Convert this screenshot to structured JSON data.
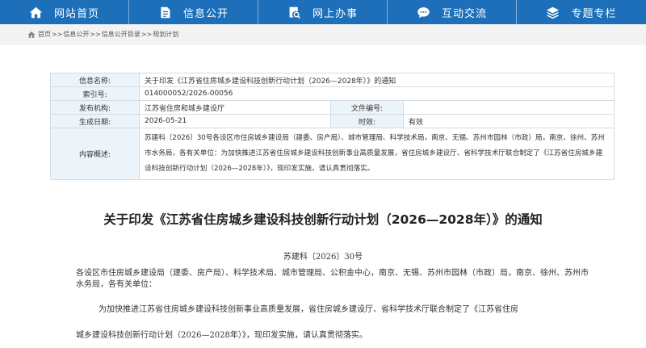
{
  "nav": [
    {
      "label": "网站首页",
      "icon": "home-icon"
    },
    {
      "label": "信息公开",
      "icon": "document-icon"
    },
    {
      "label": "网上办事",
      "icon": "search-document-icon"
    },
    {
      "label": "互动交流",
      "icon": "chat-icon"
    },
    {
      "label": "专题专栏",
      "icon": "layers-icon"
    }
  ],
  "breadcrumb": {
    "home": "首页",
    "level1": "信息公开",
    "level2": "信息公开目录",
    "level3": "规划计划",
    "separator": ">>"
  },
  "info_table": {
    "name_label": "信息名称:",
    "name_value": "关于印发《江苏省住房城乡建设科技创新行动计划（2026—2028年）》的通知",
    "index_label": "索引号:",
    "index_value": "014000052/2026-00056",
    "org_label": "发布机构:",
    "org_value": "江苏省住房和城乡建设厅",
    "fileno_label": "文件编号:",
    "fileno_value": "",
    "date_label": "生成日期:",
    "date_value": "2026-05-21",
    "validity_label": "时效:",
    "validity_value": "有效",
    "summary_label": "内容概述:",
    "summary_value": "苏建科〔2026〕30号各设区市住房城乡建设局（建委、房产局）、城市管理局、科学技术局，南京、无锡、苏州市园林（市政）局，南京、徐州、苏州市水务局，各有关单位：为加快推进江苏省住房城乡建设科技创新事业高质量发展，省住房城乡建设厅、省科学技术厅联合制定了《江苏省住房城乡建设科技创新行动计划（2026—2028年）》，现印发实施，请认真贯彻落实。"
  },
  "article": {
    "title": "关于印发《江苏省住房城乡建设科技创新行动计划（2026—2028年）》的通知",
    "doc_number": "苏建科〔2026〕30号",
    "addressee": "各设区市住房城乡建设局（建委、房产局）、科学技术局、城市管理局、公积金中心，南京、无锡、苏州市园林（市政）局，南京、徐州、苏州市水务局，各有关单位：",
    "para1": "为加快推进江苏省住房城乡建设科技创新事业高质量发展，省住房城乡建设厅、省科学技术厅联合制定了《江苏省住房",
    "para2": "城乡建设科技创新行动计划（2026—2028年）》，现印发实施，请认真贯彻落实。"
  },
  "colors": {
    "nav_bg": "#1c6fb8",
    "table_key_bg": "#ecf3f9",
    "table_border": "#d2dce6"
  }
}
